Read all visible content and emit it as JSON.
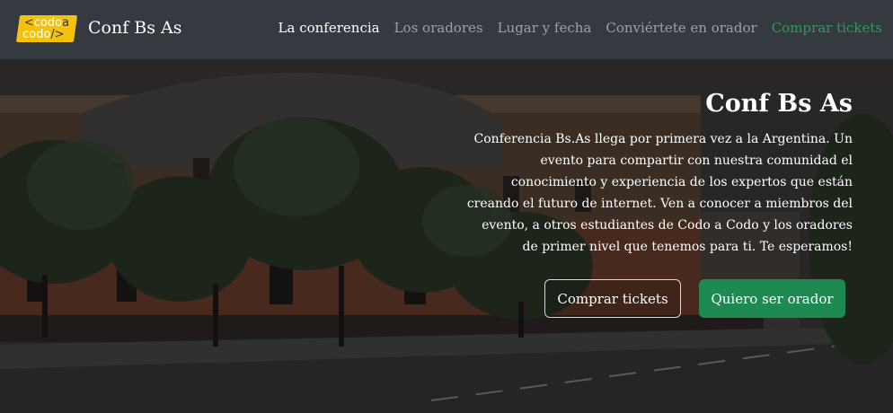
{
  "logo": {
    "line1": "codo",
    "line1_accent": "a",
    "line2": "codo",
    "line2_accent": "/>",
    "line1_prefix": "<"
  },
  "brand": {
    "title": "Conf Bs As"
  },
  "nav": {
    "items": [
      {
        "label": "La conferencia",
        "state": "active"
      },
      {
        "label": "Los oradores",
        "state": "normal"
      },
      {
        "label": "Lugar y fecha",
        "state": "normal"
      },
      {
        "label": "Conviértete en orador",
        "state": "normal"
      },
      {
        "label": "Comprar tickets",
        "state": "highlight"
      }
    ]
  },
  "hero": {
    "title": "Conf Bs As",
    "description": "Conferencia Bs.As llega por primera vez a la Argentina. Un evento para compartir con nuestra comunidad el conocimiento y experiencia de los expertos que están creando el futuro de internet. Ven a conocer a miembros del evento, a otros estudiantes de Codo a Codo y los oradores de primer nivel que tenemos para ti. Te esperamos!",
    "buttons": {
      "buy": "Comprar tickets",
      "speaker": "Quiero ser orador"
    }
  },
  "colors": {
    "navbar": "#343a40",
    "accent_green": "#1e8a52",
    "logo_yellow": "#f4c20d"
  }
}
